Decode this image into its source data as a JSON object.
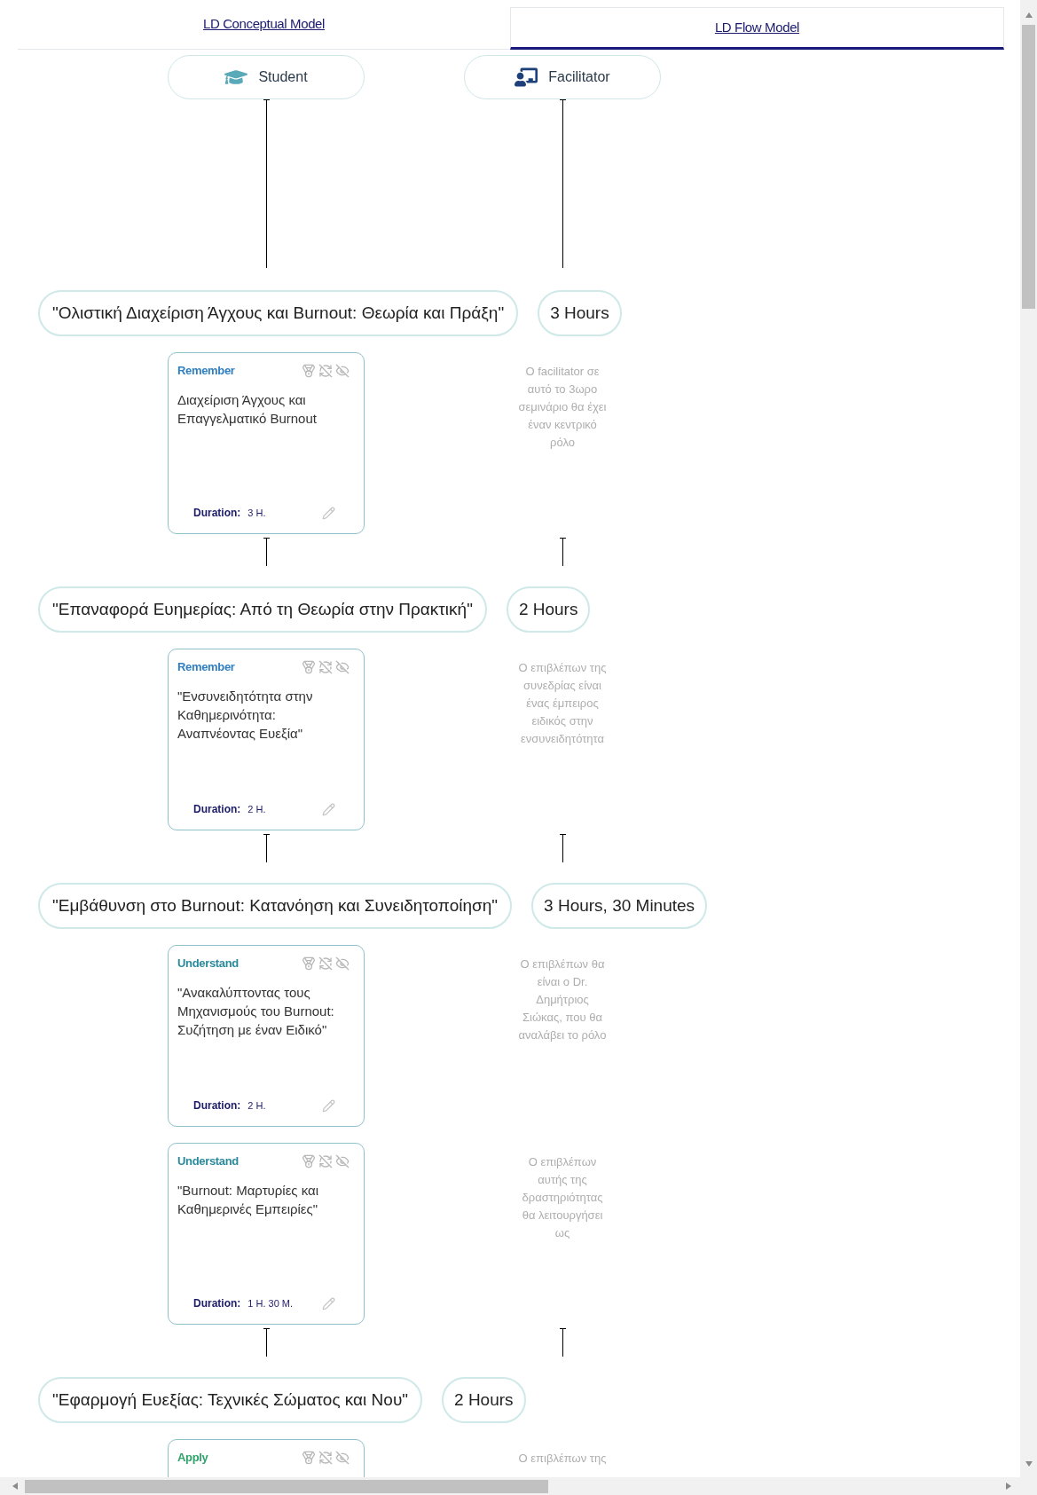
{
  "tabs": [
    {
      "label": "LD Conceptual Model",
      "selected": false
    },
    {
      "label": "LD Flow Model",
      "selected": true
    }
  ],
  "roles": [
    {
      "kind": "student",
      "label": "Student"
    },
    {
      "kind": "facilitator",
      "label": "Facilitator"
    }
  ],
  "sessions": [
    {
      "title": "\"Ολιστική Διαχείριση Άγχους και Burnout: Θεωρία και Πράξη\"",
      "duration": "3 Hours",
      "activities": [
        {
          "kind": "remember",
          "level": "Remember",
          "title": "Διαχείριση Άγχους και Επαγγελματικό Burnout",
          "duration_label": "Duration:",
          "duration": "3 H.",
          "facilitator_note": "Ο facilitator σε αυτό το 3ωρο σεμινάριο θα έχει έναν κεντρικό ρόλο"
        }
      ]
    },
    {
      "title": "\"Επαναφορά Ευημερίας: Από τη Θεωρία στην Πρακτική\"",
      "duration": "2 Hours",
      "activities": [
        {
          "kind": "remember",
          "level": "Remember",
          "title": "\"Ενσυνειδητότητα στην Καθημερινότητα: Αναπνέοντας Ευεξία\"",
          "duration_label": "Duration:",
          "duration": "2 H.",
          "facilitator_note": "Ο επιβλέπων της συνεδρίας είναι ένας έμπειρος ειδικός στην ενσυνειδητότητα"
        }
      ]
    },
    {
      "title": "\"Εμβάθυνση στο Burnout: Κατανόηση και Συνειδητοποίηση\"",
      "duration": "3 Hours, 30 Minutes",
      "activities": [
        {
          "kind": "understand",
          "level": "Understand",
          "title": "\"Ανακαλύπτοντας τους Μηχανισμούς του Burnout: Συζήτηση με έναν Ειδικό\"",
          "duration_label": "Duration:",
          "duration": "2 H.",
          "facilitator_note": "Ο επιβλέπων θα είναι ο Dr. Δημήτριος Σιώκας, που θα αναλάβει το ρόλο"
        },
        {
          "kind": "understand",
          "level": "Understand",
          "title": "\"Burnout: Μαρτυρίες και Καθημερινές Εμπειρίες\"",
          "duration_label": "Duration:",
          "duration": "1 H. 30 M.",
          "facilitator_note": "Ο επιβλέπων αυτής της δραστηριότητας θα λειτουργήσει ως"
        }
      ]
    },
    {
      "title": "\"Εφαρμογή Ευεξίας: Τεχνικές Σώματος και Νου\"",
      "duration": "2 Hours",
      "activities": [
        {
          "kind": "apply",
          "level": "Apply",
          "facilitator_note": "Ο επιβλέπων της"
        }
      ]
    }
  ]
}
